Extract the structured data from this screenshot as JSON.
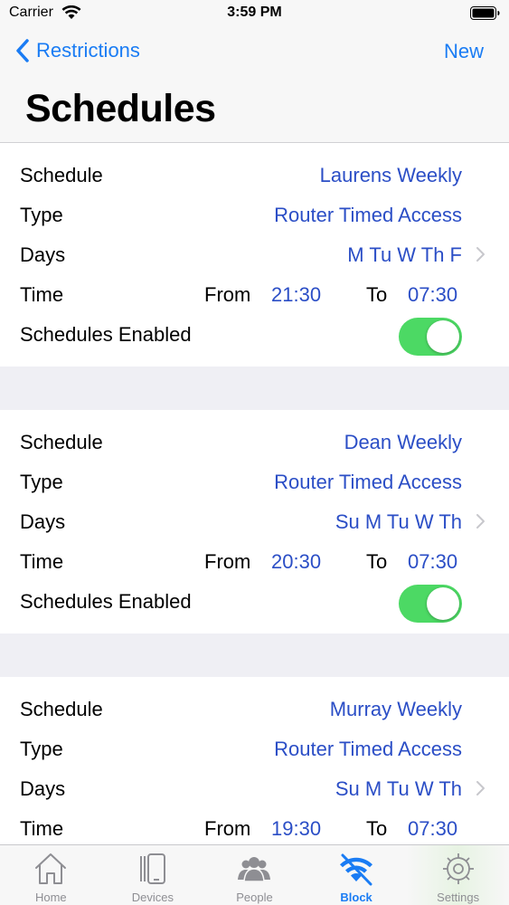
{
  "status_bar": {
    "carrier": "Carrier",
    "time": "3:59 PM"
  },
  "nav": {
    "back_label": "Restrictions",
    "new_label": "New",
    "title": "Schedules"
  },
  "labels": {
    "schedule": "Schedule",
    "type": "Type",
    "days": "Days",
    "time": "Time",
    "from": "From",
    "to": "To",
    "enabled": "Schedules Enabled"
  },
  "schedules": [
    {
      "name": "Laurens Weekly",
      "type": "Router Timed Access",
      "days": "M Tu W Th F",
      "from": "21:30",
      "to": "07:30",
      "enabled": true
    },
    {
      "name": "Dean Weekly",
      "type": "Router Timed Access",
      "days": "Su M Tu W Th",
      "from": "20:30",
      "to": "07:30",
      "enabled": true
    },
    {
      "name": "Murray Weekly",
      "type": "Router Timed Access",
      "days": "Su M Tu W Th",
      "from": "19:30",
      "to": "07:30",
      "enabled": true
    }
  ],
  "tabs": [
    {
      "label": "Home",
      "icon": "home-icon"
    },
    {
      "label": "Devices",
      "icon": "devices-icon"
    },
    {
      "label": "People",
      "icon": "people-icon"
    },
    {
      "label": "Block",
      "icon": "wifi-block-icon",
      "active": true
    },
    {
      "label": "Settings",
      "icon": "gear-icon"
    }
  ],
  "colors": {
    "accent": "#1a7cf4",
    "value_text": "#2b4ec6",
    "toggle_on": "#4cd964",
    "background": "#efeff4"
  }
}
